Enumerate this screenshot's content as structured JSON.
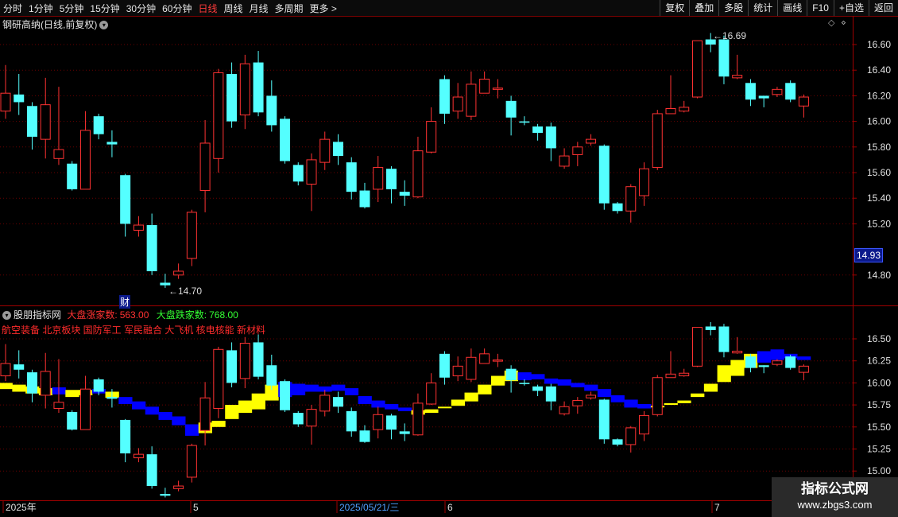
{
  "toolbar": {
    "periods": [
      "分时",
      "1分钟",
      "5分钟",
      "15分钟",
      "30分钟",
      "60分钟",
      "日线",
      "周线",
      "月线",
      "多周期",
      "更多 >"
    ],
    "active_period": "日线",
    "right_buttons": [
      "复权",
      "叠加",
      "多股",
      "统计",
      "画线",
      "F10",
      "+自选",
      "返回"
    ]
  },
  "main_panel": {
    "title": "钢研高纳(日线,前复权)",
    "price_ticks": [
      "16.60",
      "16.40",
      "16.20",
      "16.00",
      "15.80",
      "15.60",
      "15.40",
      "15.20",
      "14.80"
    ],
    "current_price": "14.93",
    "high_label": "16.69",
    "low_label": "14.70",
    "finance_marker": "财"
  },
  "indicator_panel": {
    "title": "股朋指标网",
    "up_label": "大盘涨家数:",
    "up_value": "563.00",
    "down_label": "大盘跌家数:",
    "down_value": "768.00",
    "sectors": "航空装备 北京板块 国防军工 军民融合 大飞机 核电核能 新材料",
    "price_ticks": [
      "16.50",
      "16.25",
      "16.00",
      "15.75",
      "15.50",
      "15.25",
      "15.00"
    ]
  },
  "time_axis": {
    "labels": [
      "2025年",
      "5",
      "2025/05/21/三",
      "6",
      "7"
    ]
  },
  "watermark": {
    "line1": "指标公式网",
    "line2": "www.zbgs3.com"
  },
  "colors": {
    "up": "#ff3232",
    "down": "#54ffff",
    "band_yellow": "#ffff00",
    "band_blue": "#0000ff",
    "active": "#ff3b3b"
  },
  "chart_data": {
    "type": "candlestick",
    "title": "钢研高纳(日线,前复权)",
    "ylim_main": [
      14.6,
      16.8
    ],
    "ylim_indicator": [
      14.9,
      16.6
    ],
    "candles": [
      [
        16.08,
        16.22,
        16.44,
        16.02
      ],
      [
        16.21,
        16.15,
        16.37,
        16.05
      ],
      [
        16.12,
        15.88,
        16.15,
        15.78
      ],
      [
        15.86,
        16.13,
        16.34,
        15.71
      ],
      [
        15.71,
        15.78,
        16.27,
        15.66
      ],
      [
        15.67,
        15.47,
        15.69,
        15.46
      ],
      [
        15.47,
        15.93,
        16.08,
        15.47
      ],
      [
        16.04,
        15.9,
        16.06,
        15.86
      ],
      [
        15.84,
        15.82,
        15.93,
        15.72
      ],
      [
        15.58,
        15.2,
        15.59,
        15.1
      ],
      [
        15.15,
        15.19,
        15.26,
        15.1
      ],
      [
        15.19,
        14.83,
        15.28,
        14.8
      ],
      [
        14.74,
        14.72,
        14.81,
        14.7
      ],
      [
        14.8,
        14.83,
        14.89,
        14.77
      ],
      [
        14.93,
        15.29,
        15.31,
        14.87
      ],
      [
        15.46,
        15.83,
        16.01,
        15.29
      ],
      [
        15.71,
        16.38,
        16.41,
        15.6
      ],
      [
        16.37,
        16.0,
        16.46,
        15.95
      ],
      [
        16.05,
        16.45,
        16.52,
        15.94
      ],
      [
        16.46,
        16.07,
        16.55,
        16.04
      ],
      [
        16.2,
        15.97,
        16.32,
        15.92
      ],
      [
        16.02,
        15.69,
        16.04,
        15.67
      ],
      [
        15.66,
        15.53,
        15.68,
        15.5
      ],
      [
        15.51,
        15.7,
        15.75,
        15.3
      ],
      [
        15.68,
        15.86,
        15.92,
        15.62
      ],
      [
        15.84,
        15.73,
        15.9,
        15.66
      ],
      [
        15.68,
        15.45,
        15.72,
        15.39
      ],
      [
        15.46,
        15.33,
        15.52,
        15.32
      ],
      [
        15.47,
        15.64,
        15.73,
        15.37
      ],
      [
        15.63,
        15.47,
        15.65,
        15.36
      ],
      [
        15.45,
        15.42,
        15.54,
        15.34
      ],
      [
        15.41,
        15.77,
        15.88,
        15.4
      ],
      [
        15.76,
        16.0,
        16.11,
        15.75
      ],
      [
        16.33,
        16.06,
        16.36,
        15.98
      ],
      [
        16.08,
        16.19,
        16.3,
        16.02
      ],
      [
        16.04,
        16.29,
        16.39,
        16.01
      ],
      [
        16.22,
        16.33,
        16.39,
        16.22
      ],
      [
        16.25,
        16.26,
        16.33,
        16.18
      ],
      [
        16.16,
        16.03,
        16.2,
        15.89
      ],
      [
        16.0,
        15.99,
        16.04,
        15.97
      ],
      [
        15.96,
        15.91,
        15.98,
        15.85
      ],
      [
        15.96,
        15.79,
        15.99,
        15.69
      ],
      [
        15.65,
        15.73,
        15.79,
        15.63
      ],
      [
        15.74,
        15.8,
        15.84,
        15.65
      ],
      [
        15.83,
        15.86,
        15.9,
        15.81
      ],
      [
        15.81,
        15.36,
        15.82,
        15.31
      ],
      [
        15.36,
        15.3,
        15.37,
        15.28
      ],
      [
        15.3,
        15.49,
        15.51,
        15.21
      ],
      [
        15.42,
        15.63,
        15.68,
        15.34
      ],
      [
        15.64,
        16.06,
        16.09,
        15.62
      ],
      [
        16.06,
        16.1,
        16.36,
        16.06
      ],
      [
        16.08,
        16.11,
        16.16,
        16.07
      ],
      [
        16.19,
        16.63,
        16.63,
        16.18
      ],
      [
        16.64,
        16.6,
        16.69,
        16.54
      ],
      [
        16.64,
        16.35,
        16.67,
        16.29
      ],
      [
        16.34,
        16.36,
        16.52,
        16.33
      ],
      [
        16.3,
        16.17,
        16.33,
        16.12
      ],
      [
        16.2,
        16.18,
        16.2,
        16.11
      ],
      [
        16.21,
        16.25,
        16.27,
        16.19
      ],
      [
        16.3,
        16.17,
        16.32,
        16.15
      ],
      [
        16.12,
        16.19,
        16.21,
        16.03
      ]
    ],
    "bands": [
      [
        16.0,
        15.93
      ],
      [
        15.98,
        15.9
      ],
      [
        15.96,
        15.88
      ],
      [
        15.94,
        15.86
      ],
      [
        15.95,
        15.87
      ],
      [
        15.92,
        15.84
      ],
      [
        15.92,
        15.86
      ],
      [
        15.93,
        15.88
      ],
      [
        15.9,
        15.83
      ],
      [
        15.84,
        15.76
      ],
      [
        15.79,
        15.7
      ],
      [
        15.73,
        15.64
      ],
      [
        15.67,
        15.58
      ],
      [
        15.62,
        15.52
      ],
      [
        15.53,
        15.4
      ],
      [
        15.55,
        15.43
      ],
      [
        15.57,
        15.5
      ],
      [
        15.75,
        15.59
      ],
      [
        15.8,
        15.66
      ],
      [
        15.88,
        15.7
      ],
      [
        15.98,
        15.8
      ],
      [
        16.01,
        15.84
      ],
      [
        15.99,
        15.86
      ],
      [
        15.98,
        15.9
      ],
      [
        15.96,
        15.9
      ],
      [
        15.98,
        15.91
      ],
      [
        15.94,
        15.86
      ],
      [
        15.85,
        15.76
      ],
      [
        15.8,
        15.72
      ],
      [
        15.76,
        15.7
      ],
      [
        15.72,
        15.68
      ],
      [
        15.69,
        15.64
      ],
      [
        15.7,
        15.66
      ],
      [
        15.73,
        15.72
      ],
      [
        15.81,
        15.74
      ],
      [
        15.89,
        15.79
      ],
      [
        15.98,
        15.87
      ],
      [
        16.08,
        15.97
      ],
      [
        16.14,
        16.02
      ],
      [
        16.12,
        16.03
      ],
      [
        16.1,
        16.04
      ],
      [
        16.05,
        15.99
      ],
      [
        16.04,
        15.97
      ],
      [
        16.0,
        15.95
      ],
      [
        15.98,
        15.91
      ],
      [
        15.93,
        15.84
      ],
      [
        15.86,
        15.78
      ],
      [
        15.81,
        15.72
      ],
      [
        15.76,
        15.71
      ],
      [
        15.74,
        15.73
      ],
      [
        15.77,
        15.75
      ],
      [
        15.8,
        15.77
      ],
      [
        15.88,
        15.84
      ],
      [
        15.99,
        15.9
      ],
      [
        16.2,
        16.01
      ],
      [
        16.26,
        16.08
      ],
      [
        16.33,
        16.17
      ],
      [
        16.36,
        16.23
      ],
      [
        16.38,
        16.26
      ],
      [
        16.33,
        16.28
      ],
      [
        16.3,
        16.26
      ]
    ],
    "band_color": [
      "y",
      "y",
      "y",
      "y",
      "b",
      "y",
      "y",
      "b",
      "y",
      "b",
      "b",
      "b",
      "b",
      "b",
      "b",
      "y",
      "y",
      "y",
      "y",
      "y",
      "y",
      "b",
      "b",
      "b",
      "b",
      "b",
      "b",
      "b",
      "b",
      "b",
      "b",
      "y",
      "y",
      "y",
      "y",
      "y",
      "y",
      "y",
      "y",
      "b",
      "b",
      "b",
      "b",
      "b",
      "b",
      "b",
      "b",
      "b",
      "b",
      "y",
      "y",
      "y",
      "y",
      "y",
      "y",
      "y",
      "y",
      "b",
      "b",
      "b",
      "b"
    ]
  }
}
